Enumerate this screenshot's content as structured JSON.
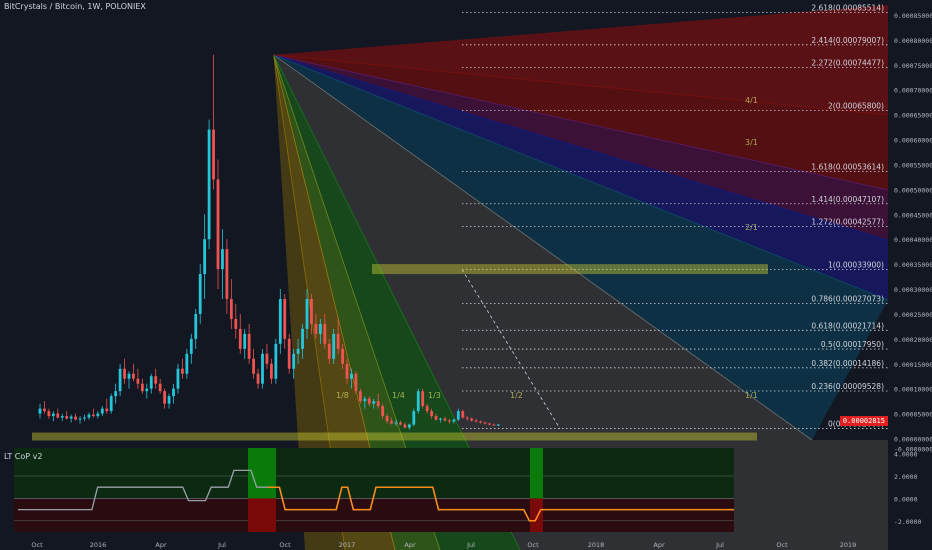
{
  "header": {
    "title": "BitCrystals / Bitcoin, 1W, POLONIEX"
  },
  "indicator": {
    "name": "LT CoP v2",
    "ticks": [
      "4.0000",
      "2.0000",
      "0.0000",
      "-2.0000"
    ]
  },
  "last_price": "0.00002815",
  "colors": {
    "bg": "#131722",
    "bull": "#26c6da",
    "bear": "#ef5350",
    "fib_label": "#d1d4dc",
    "zone": "#c8c832"
  },
  "chart_data": {
    "type": "candlestick",
    "title": "BitCrystals / Bitcoin, 1W, POLONIEX",
    "xaxis_labels": [
      "Oct",
      "2016",
      "Apr",
      "Jul",
      "Oct",
      "2017",
      "Apr",
      "Jul",
      "Oct",
      "2018",
      "Apr",
      "Jul",
      "Oct",
      "2019"
    ],
    "yaxis_ticks": [
      "0.00085000",
      "0.00080000",
      "0.00075000",
      "0.00070000",
      "0.00065000",
      "0.00060000",
      "0.00055000",
      "0.00050000",
      "0.00045000",
      "0.00040000",
      "0.00035000",
      "0.00030000",
      "0.00025000",
      "0.00020000",
      "0.00015000",
      "0.00010000",
      "0.00005000",
      "0.00000000",
      "-0.00000000"
    ],
    "ylim": [
      -3e-06,
      0.00087
    ],
    "fib_levels": [
      {
        "label": "2.618(0.00085514)",
        "value": 0.00085514
      },
      {
        "label": "2.414(0.00079007)",
        "value": 0.00079007
      },
      {
        "label": "2.272(0.00074477)",
        "value": 0.00074477
      },
      {
        "label": "2(0.00065800)",
        "value": 0.000658
      },
      {
        "label": "1.618(0.00053614)",
        "value": 0.00053614
      },
      {
        "label": "1.414(0.00047107)",
        "value": 0.00047107
      },
      {
        "label": "1.272(0.00042577)",
        "value": 0.00042577
      },
      {
        "label": "1(0.00033900)",
        "value": 0.000339
      },
      {
        "label": "0.786(0.00027073)",
        "value": 0.00027073
      },
      {
        "label": "0.618(0.00021714)",
        "value": 0.00021714
      },
      {
        "label": "0.5(0.00017950)",
        "value": 0.0001795
      },
      {
        "label": "0.382(0.00014186)",
        "value": 0.00014186
      },
      {
        "label": "0.236(0.00009528)",
        "value": 9.528e-05
      },
      {
        "label": "0(0.00002000)",
        "value": 2e-05
      }
    ],
    "gann_labels": [
      "1/8",
      "1/4",
      "1/3",
      "1/2",
      "1/1",
      "2/1",
      "3/1",
      "4/1"
    ],
    "series": [
      {
        "values": [
          [
            5e-05,
            7e-05,
            4e-05,
            6e-05
          ],
          [
            6e-05,
            7.5e-05,
            5e-05,
            5.5e-05
          ],
          [
            5.5e-05,
            6e-05,
            4e-05,
            4.5e-05
          ],
          [
            4.5e-05,
            5.5e-05,
            3.5e-05,
            5e-05
          ],
          [
            5e-05,
            6e-05,
            4e-05,
            4.2e-05
          ],
          [
            4.2e-05,
            5e-05,
            3.5e-05,
            4.5e-05
          ],
          [
            4.5e-05,
            5.5e-05,
            3.8e-05,
            4e-05
          ],
          [
            4e-05,
            4.8e-05,
            3.2e-05,
            4.4e-05
          ],
          [
            4.4e-05,
            5e-05,
            3.6e-05,
            3.8e-05
          ],
          [
            3.8e-05,
            4.5e-05,
            3e-05,
            4e-05
          ],
          [
            4e-05,
            4.8e-05,
            3.5e-05,
            4.2e-05
          ],
          [
            4.2e-05,
            5.2e-05,
            3.8e-05,
            4.8e-05
          ],
          [
            4.8e-05,
            6e-05,
            4.2e-05,
            4.5e-05
          ],
          [
            4.5e-05,
            5.5e-05,
            4e-05,
            5e-05
          ],
          [
            5e-05,
            6.5e-05,
            4.5e-05,
            6e-05
          ],
          [
            6e-05,
            8e-05,
            5e-05,
            5.5e-05
          ],
          [
            5.5e-05,
            9e-05,
            5e-05,
            8.5e-05
          ],
          [
            8.5e-05,
            0.00011,
            7e-05,
            9.5e-05
          ],
          [
            9.5e-05,
            0.00015,
            8.5e-05,
            0.00014
          ],
          [
            0.00014,
            0.00016,
            0.00011,
            0.00012
          ],
          [
            0.00012,
            0.000135,
            0.0001,
            0.00013
          ],
          [
            0.00013,
            0.00015,
            0.000115,
            0.00012
          ],
          [
            0.00012,
            0.00014,
            0.0001,
            0.00011
          ],
          [
            0.00011,
            0.00012,
            9e-05,
            9.5e-05
          ],
          [
            9.5e-05,
            0.00011,
            8e-05,
            0.0001
          ],
          [
            0.0001,
            0.00013,
            9e-05,
            0.000125
          ],
          [
            0.000125,
            0.00014,
            0.0001,
            0.00011
          ],
          [
            0.00011,
            0.00012,
            9e-05,
            9.5e-05
          ],
          [
            9.5e-05,
            0.0001,
            6e-05,
            7e-05
          ],
          [
            7e-05,
            9e-05,
            6e-05,
            8.5e-05
          ],
          [
            8.5e-05,
            0.00011,
            7e-05,
            0.0001
          ],
          [
            0.0001,
            0.00015,
            9e-05,
            0.00014
          ],
          [
            0.00014,
            0.00016,
            0.00012,
            0.00013
          ],
          [
            0.00013,
            0.00018,
            0.00012,
            0.00017
          ],
          [
            0.00017,
            0.00021,
            0.00015,
            0.0002
          ],
          [
            0.0002,
            0.00026,
            0.00018,
            0.00025
          ],
          [
            0.00025,
            0.00035,
            0.00023,
            0.00033
          ],
          [
            0.00033,
            0.00045,
            0.00028,
            0.0004
          ],
          [
            0.0004,
            0.00064,
            0.00038,
            0.00062
          ],
          [
            0.00062,
            0.00077,
            0.0005,
            0.00052
          ],
          [
            0.00052,
            0.00056,
            0.0003,
            0.00034
          ],
          [
            0.00034,
            0.00042,
            0.00028,
            0.00038
          ],
          [
            0.00038,
            0.0004,
            0.00025,
            0.00028
          ],
          [
            0.00028,
            0.00032,
            0.00022,
            0.00024
          ],
          [
            0.00024,
            0.00027,
            0.0002,
            0.00022
          ],
          [
            0.00022,
            0.00025,
            0.00017,
            0.00018
          ],
          [
            0.00018,
            0.00022,
            0.00016,
            0.00021
          ],
          [
            0.00021,
            0.00023,
            0.00015,
            0.00016
          ],
          [
            0.00016,
            0.00018,
            0.00012,
            0.00013
          ],
          [
            0.00013,
            0.00014,
            0.0001,
            0.00011
          ],
          [
            0.00011,
            0.00018,
            0.0001,
            0.00017
          ],
          [
            0.00017,
            0.00019,
            0.00014,
            0.00015
          ],
          [
            0.00015,
            0.00016,
            0.00011,
            0.00012
          ],
          [
            0.00012,
            0.0002,
            0.00011,
            0.00019
          ],
          [
            0.00019,
            0.0003,
            0.00017,
            0.00028
          ],
          [
            0.00028,
            0.00029,
            0.00018,
            0.0002
          ],
          [
            0.0002,
            0.00021,
            0.00013,
            0.00014
          ],
          [
            0.00014,
            0.00018,
            0.00012,
            0.00017
          ],
          [
            0.00017,
            0.0002,
            0.00015,
            0.00018
          ],
          [
            0.00018,
            0.00023,
            0.00016,
            0.00022
          ],
          [
            0.00022,
            0.0003,
            0.0002,
            0.00028
          ],
          [
            0.00028,
            0.00029,
            0.00021,
            0.00023
          ],
          [
            0.00023,
            0.00025,
            0.0002,
            0.00021
          ],
          [
            0.00021,
            0.00024,
            0.00019,
            0.00023
          ],
          [
            0.00023,
            0.00025,
            0.00018,
            0.00019
          ],
          [
            0.00019,
            0.0002,
            0.00015,
            0.00016
          ],
          [
            0.00016,
            0.00022,
            0.00015,
            0.00021
          ],
          [
            0.00021,
            0.00024,
            0.00017,
            0.00018
          ],
          [
            0.00018,
            0.00019,
            0.00014,
            0.00015
          ],
          [
            0.00015,
            0.00016,
            0.00011,
            0.00012
          ],
          [
            0.00012,
            0.00014,
            0.0001,
            0.00013
          ],
          [
            0.00013,
            0.000135,
            9e-05,
            9.5e-05
          ],
          [
            9.5e-05,
            0.0001,
            7e-05,
            7.5e-05
          ],
          [
            7.5e-05,
            8.5e-05,
            6e-05,
            8e-05
          ],
          [
            8e-05,
            8.5e-05,
            6.5e-05,
            7e-05
          ],
          [
            7e-05,
            8e-05,
            6e-05,
            7.5e-05
          ],
          [
            7.5e-05,
            9e-05,
            6e-05,
            6.5e-05
          ],
          [
            6.5e-05,
            7e-05,
            4e-05,
            4.5e-05
          ],
          [
            4.5e-05,
            5e-05,
            3e-05,
            3.5e-05
          ],
          [
            3.5e-05,
            4.2e-05,
            2.8e-05,
            3e-05
          ],
          [
            3e-05,
            3.8e-05,
            2.5e-05,
            3.2e-05
          ],
          [
            3.2e-05,
            3.6e-05,
            2.6e-05,
            2.8e-05
          ],
          [
            2.8e-05,
            3.2e-05,
            2e-05,
            2.2e-05
          ],
          [
            2.2e-05,
            3e-05,
            1.8e-05,
            2.8e-05
          ],
          [
            2.8e-05,
            6e-05,
            2.5e-05,
            5.5e-05
          ],
          [
            5.5e-05,
            0.0001,
            5e-05,
            9.5e-05
          ],
          [
            9.5e-05,
            0.0001,
            6e-05,
            6.5e-05
          ],
          [
            6.5e-05,
            7e-05,
            5e-05,
            5.5e-05
          ],
          [
            5.5e-05,
            6e-05,
            4e-05,
            4.5e-05
          ],
          [
            4.5e-05,
            5e-05,
            3.5e-05,
            3.8e-05
          ],
          [
            3.8e-05,
            4.2e-05,
            3.2e-05,
            4e-05
          ],
          [
            4e-05,
            4.4e-05,
            3.4e-05,
            3.6e-05
          ],
          [
            3.6e-05,
            4e-05,
            3e-05,
            3.4e-05
          ],
          [
            3.4e-05,
            4e-05,
            3e-05,
            3.8e-05
          ],
          [
            3.8e-05,
            6e-05,
            3.5e-05,
            5.5e-05
          ],
          [
            5.5e-05,
            5.8e-05,
            4e-05,
            4.2e-05
          ],
          [
            4.2e-05,
            4.5e-05,
            3.6e-05,
            4e-05
          ],
          [
            4e-05,
            4.2e-05,
            3.4e-05,
            3.6e-05
          ],
          [
            3.6e-05,
            4e-05,
            3.2e-05,
            3.4e-05
          ],
          [
            3.4e-05,
            3.6e-05,
            3e-05,
            3.2e-05
          ],
          [
            3.2e-05,
            3.4e-05,
            2.8e-05,
            3e-05
          ],
          [
            3e-05,
            3.2e-05,
            2.6e-05,
            2.8e-05
          ],
          [
            2.8e-05,
            3e-05,
            2.6e-05,
            2.7e-05
          ],
          [
            2.7e-05,
            2.9e-05,
            2.5e-05,
            2.8e-05
          ]
        ]
      }
    ],
    "indicator": {
      "name": "LT CoP v2",
      "ylim": [
        -3,
        4.5
      ],
      "values": [
        -1,
        -1,
        -1,
        -1,
        -1,
        -1,
        -1,
        -1,
        -1,
        -1,
        -1,
        -1,
        -1,
        -1,
        1,
        1,
        1,
        1,
        1,
        1,
        1,
        1,
        1,
        1,
        1,
        1,
        1,
        1,
        1,
        1,
        -0.2,
        -0.2,
        -0.2,
        -0.2,
        1,
        1,
        1,
        1,
        2.5,
        2.5,
        2.5,
        2.5,
        1,
        1,
        1,
        1,
        1,
        -1,
        -1,
        -1,
        -1,
        -1,
        -1,
        -1,
        -1,
        -1,
        -1,
        1,
        1,
        -1,
        -1,
        -1,
        -1,
        1,
        1,
        1,
        1,
        1,
        1,
        1,
        1,
        1,
        1,
        1,
        -1,
        -1,
        -1,
        -1,
        -1,
        -1,
        -1,
        -1,
        -1,
        -1,
        -1,
        -1,
        -1,
        -1,
        -1,
        -1,
        -2,
        -2,
        -1,
        -1,
        -1,
        -1,
        -1,
        -1,
        -1,
        -1,
        -1,
        -1,
        -1,
        -1,
        -1,
        -1,
        -1,
        -1,
        -1,
        -1,
        -1,
        -1,
        -1,
        -1,
        -1,
        -1,
        -1,
        -1,
        -1,
        -1,
        -1,
        -1,
        -1,
        -1,
        -1,
        -1,
        -1
      ]
    }
  }
}
